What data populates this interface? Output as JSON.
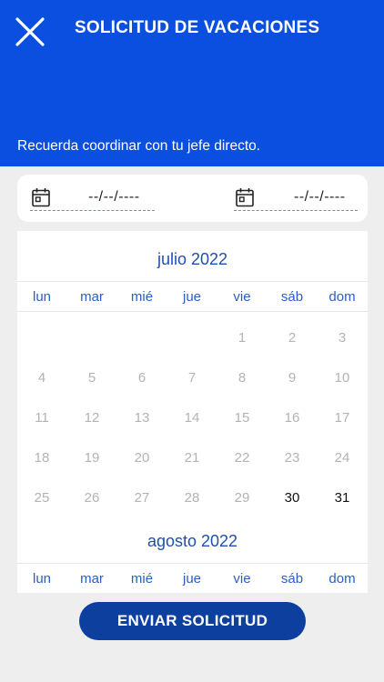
{
  "header": {
    "title": "SOLICITUD DE VACACIONES",
    "subtitle": "Recuerda coordinar con tu jefe directo.",
    "background_color": "#0a4fe0"
  },
  "date_range": {
    "start_value": "--/--/----",
    "end_value": "--/--/----",
    "icon": "calendar-icon"
  },
  "calendar": {
    "weekdays": [
      "lun",
      "mar",
      "mié",
      "jue",
      "vie",
      "sáb",
      "dom"
    ],
    "months": [
      {
        "title": "julio 2022",
        "leading_blank_days": 4,
        "days": 31,
        "active_days": [
          30,
          31
        ]
      },
      {
        "title": "agosto 2022",
        "leading_blank_days": 0,
        "days": 0,
        "active_days": []
      }
    ]
  },
  "footer": {
    "submit_label": "ENVIAR SOLICITUD",
    "button_color": "#0d3f9e"
  }
}
